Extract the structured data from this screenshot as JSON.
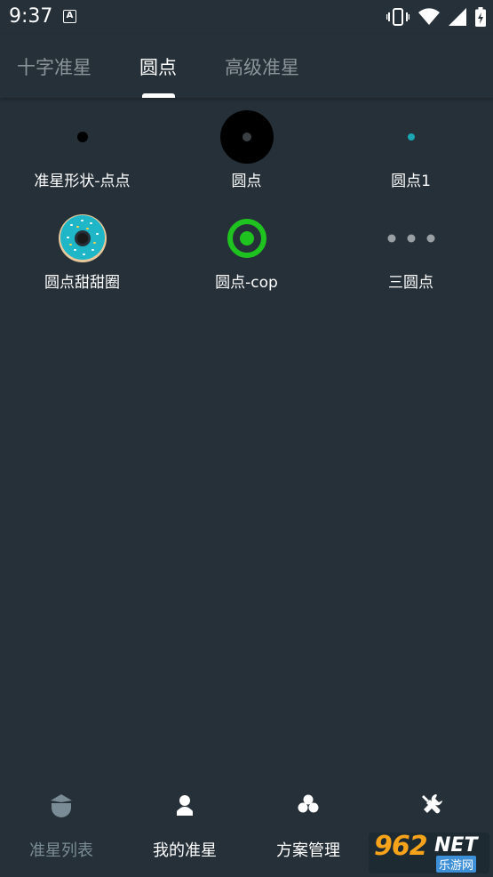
{
  "status_bar": {
    "time": "9:37",
    "notification_icon": "A",
    "icons": [
      "vibrate-icon",
      "wifi-icon",
      "signal-icon",
      "battery-icon"
    ]
  },
  "tabs": [
    {
      "label": "十字准星",
      "active": false
    },
    {
      "label": "圆点",
      "active": true
    },
    {
      "label": "高级准星",
      "active": false
    }
  ],
  "crosshairs": [
    {
      "label": "准星形状-点点",
      "icon": "small-black-dot-icon"
    },
    {
      "label": "圆点",
      "icon": "large-black-circle-icon"
    },
    {
      "label": "圆点1",
      "icon": "tiny-teal-dot-icon"
    },
    {
      "label": "圆点甜甜圈",
      "icon": "donut-icon"
    },
    {
      "label": "圆点-cop",
      "icon": "green-ring-dot-icon"
    },
    {
      "label": "三圆点",
      "icon": "three-dots-icon"
    }
  ],
  "bottom_nav": [
    {
      "label": "准星列表",
      "icon": "crosshair-list-icon",
      "active": true
    },
    {
      "label": "我的准星",
      "icon": "user-icon",
      "active": false
    },
    {
      "label": "方案管理",
      "icon": "clover-icon",
      "active": false
    },
    {
      "label": "",
      "icon": "tools-icon",
      "active": false
    }
  ],
  "watermark": {
    "brand": "962",
    "suffix": "NET",
    "subtitle": "乐游网"
  },
  "colors": {
    "background": "#263038",
    "accent_teal": "#1aa6b2",
    "ring_green": "#1fc31f",
    "inactive_tab": "#8a9499",
    "watermark_orange": "#f6a31b"
  }
}
